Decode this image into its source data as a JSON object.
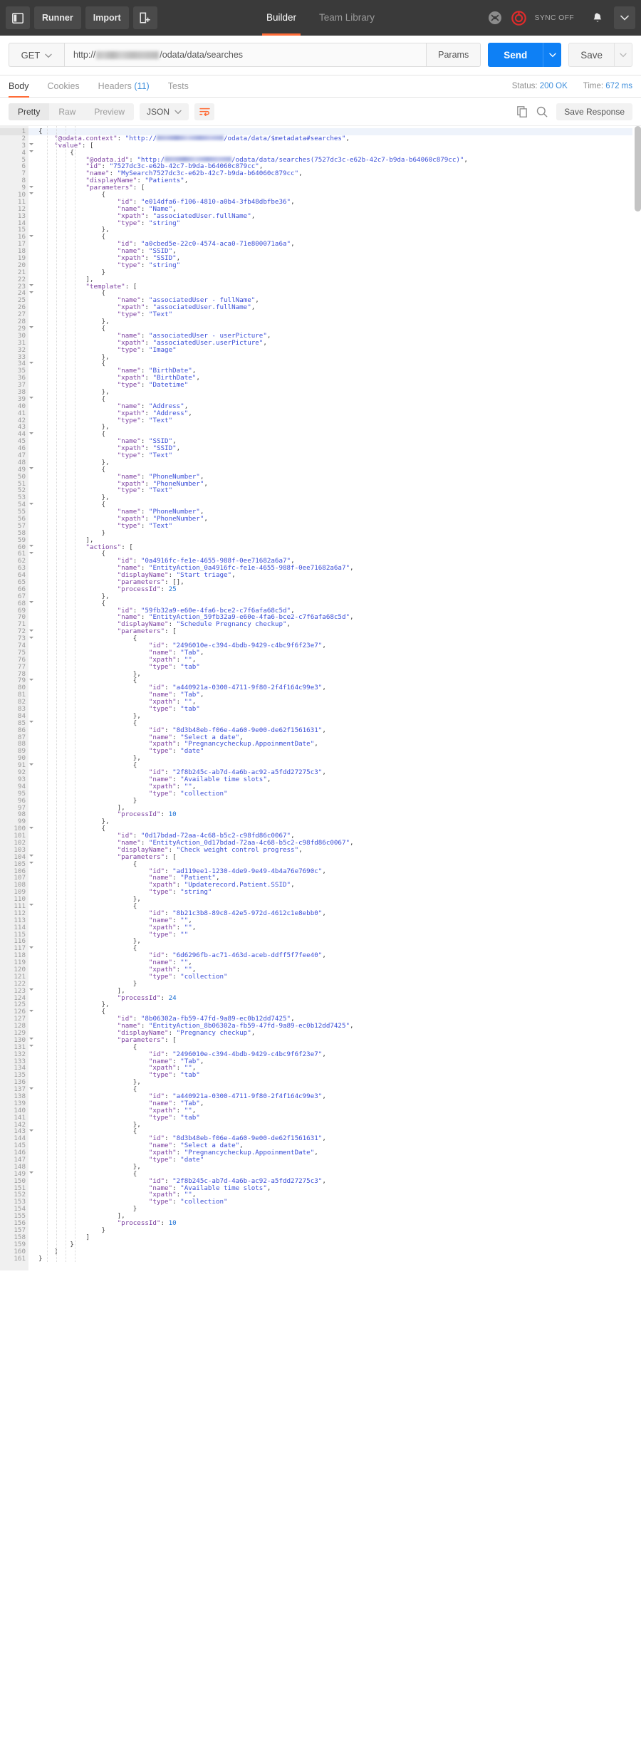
{
  "topbar": {
    "sidebar_toggle_icon": "sidebar-panel-icon",
    "runner_label": "Runner",
    "import_label": "Import",
    "new_tab_icon": "new-window-icon",
    "mode_tabs": [
      {
        "label": "Builder",
        "active": true
      },
      {
        "label": "Team Library",
        "active": false
      }
    ],
    "interceptor_icon": "interceptor-satellite-icon",
    "sync_icon": "sync-circle-icon",
    "sync_label": "SYNC OFF",
    "bell_icon": "bell-icon",
    "caret_icon": "chevron-down-icon",
    "accent_color": "#ff6c37",
    "background_color": "#3a3a3a"
  },
  "request": {
    "method": "GET",
    "method_caret_icon": "chevron-down-icon",
    "url_prefix": "http://",
    "url_redacted": true,
    "url_suffix": "/odata/data/searches",
    "url_placeholder": "Enter request URL",
    "params_label": "Params",
    "send_label": "Send",
    "send_caret_icon": "chevron-down-icon",
    "send_color": "#0e80f5",
    "save_label": "Save",
    "save_caret_icon": "chevron-down-icon"
  },
  "response": {
    "tabs": [
      {
        "label": "Body",
        "count": "",
        "active": true
      },
      {
        "label": "Cookies",
        "count": "",
        "active": false
      },
      {
        "label": "Headers",
        "count": "(11)",
        "active": false
      },
      {
        "label": "Tests",
        "count": "",
        "active": false
      }
    ],
    "status_label": "Status:",
    "status_value": "200 OK",
    "time_label": "Time:",
    "time_value": "672 ms",
    "link_color": "#3f8fdc"
  },
  "format_bar": {
    "view_modes": [
      {
        "label": "Pretty",
        "active": true
      },
      {
        "label": "Raw",
        "active": false
      },
      {
        "label": "Preview",
        "active": false
      }
    ],
    "language": "JSON",
    "language_caret_icon": "chevron-down-icon",
    "wrap_icon": "word-wrap-icon",
    "copy_icon": "copy-icon",
    "search_icon": "search-icon",
    "save_response_label": "Save Response"
  },
  "editor": {
    "first_line": 1,
    "last_line": 161,
    "cursor_line": 1,
    "fold_lines": [
      1,
      3,
      4,
      9,
      10,
      16,
      23,
      24,
      29,
      34,
      39,
      44,
      49,
      54,
      60,
      61,
      68,
      72,
      73,
      79,
      85,
      91,
      100,
      104,
      105,
      111,
      117,
      123,
      126,
      130,
      131,
      137,
      143,
      149
    ],
    "lines": [
      "{",
      "    \"@odata.context\": \"http://§/odata/data/$metadata#searches\",",
      "    \"value\": [",
      "        {",
      "            \"@odata.id\": \"http:/§/odata/data/searches(7527dc3c-e62b-42c7-b9da-b64060c879cc)\",",
      "            \"id\": \"7527dc3c-e62b-42c7-b9da-b64060c879cc\",",
      "            \"name\": \"MySearch7527dc3c-e62b-42c7-b9da-b64060c879cc\",",
      "            \"displayName\": \"Patients\",",
      "            \"parameters\": [",
      "                {",
      "                    \"id\": \"e014dfa6-f106-4810-a0b4-3fb48dbfbe36\",",
      "                    \"name\": \"Name\",",
      "                    \"xpath\": \"associatedUser.fullName\",",
      "                    \"type\": \"string\"",
      "                },",
      "                {",
      "                    \"id\": \"a0cbed5e-22c0-4574-aca0-71e800071a6a\",",
      "                    \"name\": \"SSID\",",
      "                    \"xpath\": \"SSID\",",
      "                    \"type\": \"string\"",
      "                }",
      "            ],",
      "            \"template\": [",
      "                {",
      "                    \"name\": \"associatedUser - fullName\",",
      "                    \"xpath\": \"associatedUser.fullName\",",
      "                    \"type\": \"Text\"",
      "                },",
      "                {",
      "                    \"name\": \"associatedUser - userPicture\",",
      "                    \"xpath\": \"associatedUser.userPicture\",",
      "                    \"type\": \"Image\"",
      "                },",
      "                {",
      "                    \"name\": \"BirthDate\",",
      "                    \"xpath\": \"BirthDate\",",
      "                    \"type\": \"Datetime\"",
      "                },",
      "                {",
      "                    \"name\": \"Address\",",
      "                    \"xpath\": \"Address\",",
      "                    \"type\": \"Text\"",
      "                },",
      "                {",
      "                    \"name\": \"SSID\",",
      "                    \"xpath\": \"SSID\",",
      "                    \"type\": \"Text\"",
      "                },",
      "                {",
      "                    \"name\": \"PhoneNumber\",",
      "                    \"xpath\": \"PhoneNumber\",",
      "                    \"type\": \"Text\"",
      "                },",
      "                {",
      "                    \"name\": \"PhoneNumber\",",
      "                    \"xpath\": \"PhoneNumber\",",
      "                    \"type\": \"Text\"",
      "                }",
      "            ],",
      "            \"actions\": [",
      "                {",
      "                    \"id\": \"0a4916fc-fe1e-4655-988f-0ee71682a6a7\",",
      "                    \"name\": \"EntityAction_0a4916fc-fe1e-4655-988f-0ee71682a6a7\",",
      "                    \"displayName\": \"Start triage\",",
      "                    \"parameters\": [],",
      "                    \"processId\": 25",
      "                },",
      "                {",
      "                    \"id\": \"59fb32a9-e60e-4fa6-bce2-c7f6afa68c5d\",",
      "                    \"name\": \"EntityAction_59fb32a9-e60e-4fa6-bce2-c7f6afa68c5d\",",
      "                    \"displayName\": \"Schedule Pregnancy checkup\",",
      "                    \"parameters\": [",
      "                        {",
      "                            \"id\": \"2496010e-c394-4bdb-9429-c4bc9f6f23e7\",",
      "                            \"name\": \"Tab\",",
      "                            \"xpath\": \"\",",
      "                            \"type\": \"tab\"",
      "                        },",
      "                        {",
      "                            \"id\": \"a440921a-0300-4711-9f80-2f4f164c99e3\",",
      "                            \"name\": \"Tab\",",
      "                            \"xpath\": \"\",",
      "                            \"type\": \"tab\"",
      "                        },",
      "                        {",
      "                            \"id\": \"8d3b48eb-f06e-4a60-9e00-de62f1561631\",",
      "                            \"name\": \"Select a date\",",
      "                            \"xpath\": \"Pregnancycheckup.AppoinmentDate\",",
      "                            \"type\": \"date\"",
      "                        },",
      "                        {",
      "                            \"id\": \"2f8b245c-ab7d-4a6b-ac92-a5fdd27275c3\",",
      "                            \"name\": \"Available time slots\",",
      "                            \"xpath\": \"\",",
      "                            \"type\": \"collection\"",
      "                        }",
      "                    ],",
      "                    \"processId\": 10",
      "                },",
      "                {",
      "                    \"id\": \"0d17bdad-72aa-4c68-b5c2-c98fd86c0067\",",
      "                    \"name\": \"EntityAction_0d17bdad-72aa-4c68-b5c2-c98fd86c0067\",",
      "                    \"displayName\": \"Check weight control progress\",",
      "                    \"parameters\": [",
      "                        {",
      "                            \"id\": \"ad119ee1-1230-4de9-9e49-4b4a76e7690c\",",
      "                            \"name\": \"Patient\",",
      "                            \"xpath\": \"Updaterecord.Patient.SSID\",",
      "                            \"type\": \"string\"",
      "                        },",
      "                        {",
      "                            \"id\": \"8b21c3b8-89c8-42e5-972d-4612c1e8ebb0\",",
      "                            \"name\": \"\",",
      "                            \"xpath\": \"\",",
      "                            \"type\": \"\"",
      "                        },",
      "                        {",
      "                            \"id\": \"6d6296fb-ac71-463d-aceb-ddff5f7fee40\",",
      "                            \"name\": \"\",",
      "                            \"xpath\": \"\",",
      "                            \"type\": \"collection\"",
      "                        }",
      "                    ],",
      "                    \"processId\": 24",
      "                },",
      "                {",
      "                    \"id\": \"8b06302a-fb59-47fd-9a89-ec0b12dd7425\",",
      "                    \"name\": \"EntityAction_8b06302a-fb59-47fd-9a89-ec0b12dd7425\",",
      "                    \"displayName\": \"Pregnancy checkup\",",
      "                    \"parameters\": [",
      "                        {",
      "                            \"id\": \"2496010e-c394-4bdb-9429-c4bc9f6f23e7\",",
      "                            \"name\": \"Tab\",",
      "                            \"xpath\": \"\",",
      "                            \"type\": \"tab\"",
      "                        },",
      "                        {",
      "                            \"id\": \"a440921a-0300-4711-9f80-2f4f164c99e3\",",
      "                            \"name\": \"Tab\",",
      "                            \"xpath\": \"\",",
      "                            \"type\": \"tab\"",
      "                        },",
      "                        {",
      "                            \"id\": \"8d3b48eb-f06e-4a60-9e00-de62f1561631\",",
      "                            \"name\": \"Select a date\",",
      "                            \"xpath\": \"Pregnancycheckup.AppoinmentDate\",",
      "                            \"type\": \"date\"",
      "                        },",
      "                        {",
      "                            \"id\": \"2f8b245c-ab7d-4a6b-ac92-a5fdd27275c3\",",
      "                            \"name\": \"Available time slots\",",
      "                            \"xpath\": \"\",",
      "                            \"type\": \"collection\"",
      "                        }",
      "                    ],",
      "                    \"processId\": 10",
      "                }",
      "            ]",
      "        }",
      "    ]",
      "}"
    ]
  }
}
